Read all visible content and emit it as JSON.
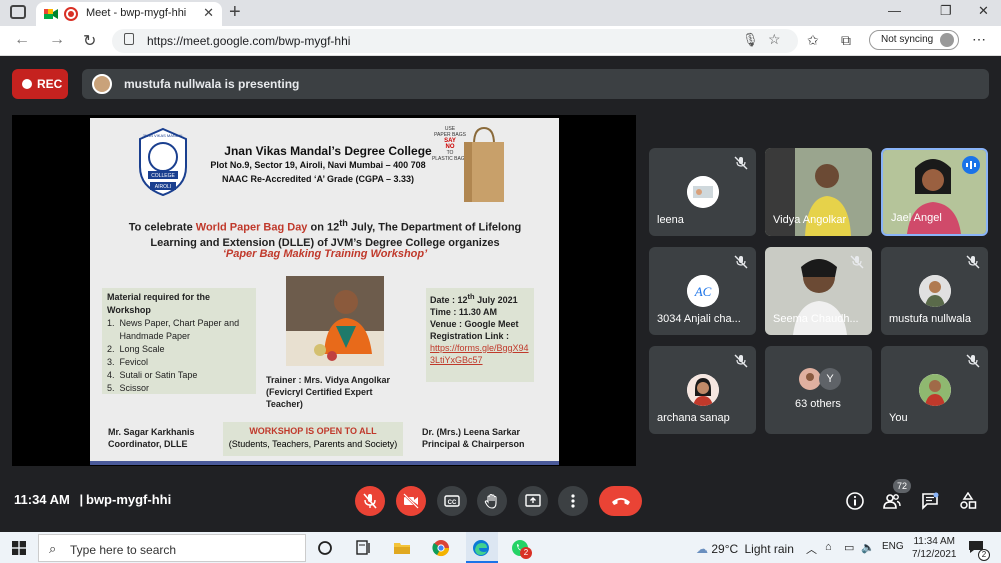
{
  "browser": {
    "tab_title": "Meet - bwp-mygf-hhi",
    "url": "https://meet.google.com/bwp-mygf-hhi",
    "sync_label": "Not syncing"
  },
  "meet": {
    "rec_label": "REC",
    "presenting_text": "mustufa nullwala is presenting",
    "time": "11:34 AM",
    "separator": "|",
    "meeting_code": "bwp-mygf-hhi",
    "participant_count": "72"
  },
  "slide": {
    "college_name": "Jnan Vikas Mandal’s Degree College",
    "address": "Plot No.9, Sector 19, Airoli, Navi Mumbai – 400 708",
    "naac": "NAAC Re-Accredited ‘A’ Grade (CGPA – 3.33)",
    "logo_top": "JNAN VIKAS MANDAL",
    "logo_mid": "COLLEGE",
    "logo_bottom": "AIROLI",
    "bag_use": "USE",
    "bag_paper": "PAPER BAGS",
    "bag_say": "SAY",
    "bag_no": "NO",
    "bag_to": "TO",
    "bag_plastic": "PLASTIC BAGS",
    "celebrate_pre": "To celebrate ",
    "celebrate_red": "World Paper Bag Day",
    "celebrate_post1": " on 12",
    "celebrate_sup": "th",
    "celebrate_post2": " July, The Department of Lifelong Learning and Extension (DLLE) of JVM’s Degree College organizes",
    "workshop_title": "‘Paper Bag Making Training Workshop’",
    "material_header": "Material required for the Workshop",
    "materials": [
      "1.  News Paper, Chart Paper and",
      "     Handmade Paper",
      "2.  Long Scale",
      "3.  Fevicol",
      "4.  Sutali or Satin Tape",
      "5.  Scissor"
    ],
    "trainer_line1": "Trainer : Mrs. Vidya Angolkar",
    "trainer_line2": "(Fevicryl Certified Expert Teacher)",
    "date_pre": "Date : 12",
    "date_sup": "th",
    "date_post": " July 2021",
    "time": "Time : 11.30 AM",
    "venue": "Venue : Google Meet",
    "reg": "Registration Link :",
    "link1": "https://forms.gle/BggX94",
    "link2": "3LtiYxGBc57",
    "coord1": "Mr. Sagar Karkhanis",
    "coord2": "Coordinator, DLLE",
    "open_hdr": "WORKSHOP IS OPEN TO ALL",
    "open_sub": "(Students, Teachers, Parents and Society)",
    "principal1": "Dr. (Mrs.) Leena Sarkar",
    "principal2": "Principal & Chairperson"
  },
  "participants": [
    {
      "name": "leena"
    },
    {
      "name": "Vidya Angolkar"
    },
    {
      "name": "Jael Angel"
    },
    {
      "name": "3034 Anjali cha..."
    },
    {
      "name": "Seema Chaudh..."
    },
    {
      "name": "mustufa nullwala"
    },
    {
      "name": "archana sanap"
    },
    {
      "name": "63 others",
      "avatar_letter": "Y"
    },
    {
      "name": "You"
    }
  ],
  "taskbar": {
    "search_placeholder": "Type here to search",
    "temp": "29°C",
    "weather": "Light rain",
    "lang": "ENG",
    "time": "11:34 AM",
    "date": "7/12/2021",
    "chat_badge": "2",
    "notif_count": "2"
  },
  "colors": {
    "accent_red": "#ea4335",
    "meet_bg": "#202124",
    "tile_bg": "#3c4043",
    "active_speaker": "#8ab4f8"
  }
}
